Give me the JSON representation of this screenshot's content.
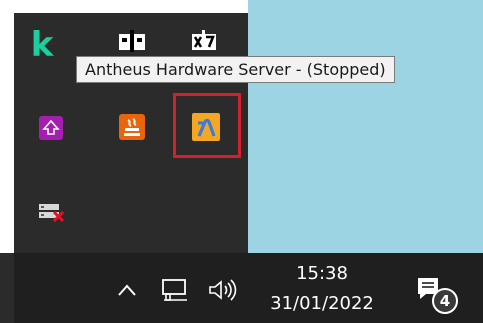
{
  "tooltip": {
    "text": "Antheus Hardware Server - (Stopped)"
  },
  "tray_icons": [
    {
      "name": "kaspersky-k-icon",
      "glyph": "k"
    },
    {
      "name": "device-monitor-icon"
    },
    {
      "name": "hardware-chip-icon"
    },
    {
      "name": "purple-upload-icon"
    },
    {
      "name": "java-icon"
    },
    {
      "name": "antheus-hardware-server-icon"
    },
    {
      "name": "network-error-icon"
    }
  ],
  "taskbar": {
    "time": "15:38",
    "date": "31/01/2022",
    "notification_count": "4",
    "icons": [
      "chevron-up-icon",
      "network-icon",
      "volume-icon",
      "action-center-icon"
    ]
  },
  "colors": {
    "flyout_bg": "#2b2b2b",
    "taskbar_bg": "#1f1f1f",
    "desktop_bg": "#9dd4e4",
    "highlight_outline": "#d4202a",
    "antheus_icon_bg": "#f5a623",
    "kaspersky_green": "#1dcf9f"
  }
}
